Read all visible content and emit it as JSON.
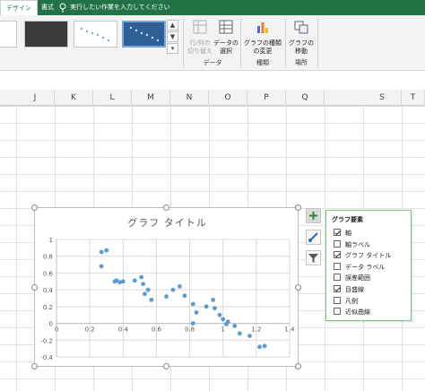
{
  "ribbon_tabs": [
    "デザイン",
    "書式"
  ],
  "tell_me": "実行したい作業を入力してください",
  "ribbon": {
    "switch_row_col": "行/列の\n切り替え",
    "select_data": "データの\n選択",
    "change_type": "グラフの種類\nの変更",
    "move_chart": "グラフの\n移動",
    "group_data": "データ",
    "group_type": "種類",
    "group_location": "場所"
  },
  "columns": [
    "J",
    "K",
    "L",
    "M",
    "N",
    "O",
    "P",
    "Q",
    "S",
    "T"
  ],
  "chart": {
    "title": "グラフ タイトル"
  },
  "chart_data": {
    "type": "scatter",
    "title": "グラフ タイトル",
    "xlim": [
      0,
      1.4
    ],
    "ylim": [
      -0.4,
      1
    ],
    "xticks": [
      "0",
      "0.2",
      "0.4",
      "0.6",
      "0.8",
      "1",
      "1.2",
      "1.4"
    ],
    "yticks": [
      "1",
      "0.8",
      "0.6",
      "0.4",
      "0.2",
      "0",
      "-0.2",
      "-0.4"
    ],
    "grid": true,
    "points": [
      [
        0.27,
        0.85
      ],
      [
        0.3,
        0.87
      ],
      [
        0.27,
        0.68
      ],
      [
        0.35,
        0.5
      ],
      [
        0.36,
        0.51
      ],
      [
        0.38,
        0.49
      ],
      [
        0.4,
        0.5
      ],
      [
        0.47,
        0.51
      ],
      [
        0.51,
        0.55
      ],
      [
        0.52,
        0.47
      ],
      [
        0.53,
        0.35
      ],
      [
        0.55,
        0.4
      ],
      [
        0.57,
        0.28
      ],
      [
        0.66,
        0.32
      ],
      [
        0.7,
        0.4
      ],
      [
        0.74,
        0.44
      ],
      [
        0.77,
        0.33
      ],
      [
        0.82,
        0.23
      ],
      [
        0.84,
        0.13
      ],
      [
        0.9,
        0.2
      ],
      [
        0.94,
        0.28
      ],
      [
        0.95,
        0.18
      ],
      [
        0.98,
        0.1
      ],
      [
        1.0,
        0.05
      ],
      [
        1.03,
        0.02
      ],
      [
        1.07,
        -0.03
      ],
      [
        1.1,
        -0.12
      ],
      [
        1.16,
        -0.15
      ],
      [
        1.22,
        -0.28
      ],
      [
        1.25,
        -0.27
      ],
      [
        0.82,
        -0.0
      ],
      [
        1.02,
        -0.01
      ]
    ]
  },
  "chart_elements": {
    "title": "グラフ要素",
    "items": [
      {
        "label": "軸",
        "checked": true
      },
      {
        "label": "軸ラベル",
        "checked": false
      },
      {
        "label": "グラフ タイトル",
        "checked": true
      },
      {
        "label": "データ ラベル",
        "checked": false
      },
      {
        "label": "誤差範囲",
        "checked": false
      },
      {
        "label": "目盛線",
        "checked": true
      },
      {
        "label": "凡例",
        "checked": false
      },
      {
        "label": "近似曲線",
        "checked": false
      }
    ]
  }
}
